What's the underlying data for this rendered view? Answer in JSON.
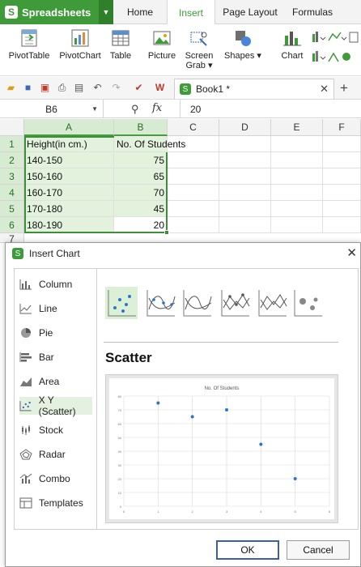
{
  "app": {
    "name": "Spreadsheets",
    "logo_glyph": "S",
    "brand_color": "#3f9a3a"
  },
  "tabs": [
    "Home",
    "Insert",
    "Page Layout",
    "Formulas"
  ],
  "active_tab": "Insert",
  "ribbon": {
    "pivot_table": "PivotTable",
    "pivot_chart": "PivotChart",
    "table": "Table",
    "picture": "Picture",
    "screen_grab_line1": "Screen",
    "screen_grab_line2": "Grab ▾",
    "shapes": "Shapes ▾",
    "chart": "Chart"
  },
  "document": {
    "tab_title": "Book1 *"
  },
  "formula_bar": {
    "name_box": "B6",
    "fx": "fx",
    "value": "20"
  },
  "sheet": {
    "columns": [
      "A",
      "B",
      "C",
      "D",
      "E",
      "F"
    ],
    "rows": [
      "1",
      "2",
      "3",
      "4",
      "5",
      "6",
      "7"
    ],
    "header_row": [
      "Height(in cm.)",
      "No. Of Students"
    ],
    "data": [
      [
        "140-150",
        "75"
      ],
      [
        "150-160",
        "65"
      ],
      [
        "160-170",
        "70"
      ],
      [
        "170-180",
        "45"
      ],
      [
        "180-190",
        "20"
      ]
    ]
  },
  "dialog": {
    "title": "Insert Chart",
    "chart_types": [
      "Column",
      "Line",
      "Pie",
      "Bar",
      "Area",
      "X Y (Scatter)",
      "Stock",
      "Radar",
      "Combo",
      "Templates"
    ],
    "selected_type": "X Y (Scatter)",
    "subtype_heading": "Scatter",
    "ok_label": "OK",
    "cancel_label": "Cancel"
  },
  "chart_data": {
    "type": "scatter",
    "title": "No. Of Students",
    "x": [
      1,
      2,
      3,
      4,
      5
    ],
    "y": [
      75,
      65,
      70,
      45,
      20
    ],
    "xlim": [
      0,
      6
    ],
    "ylim": [
      0,
      80
    ],
    "x_ticks": [
      "0",
      "1",
      "2",
      "3",
      "4",
      "5",
      "6"
    ],
    "y_ticks": [
      "0",
      "10",
      "20",
      "30",
      "40",
      "50",
      "60",
      "70",
      "80"
    ],
    "grid": true,
    "series_color": "#2e75c8"
  }
}
